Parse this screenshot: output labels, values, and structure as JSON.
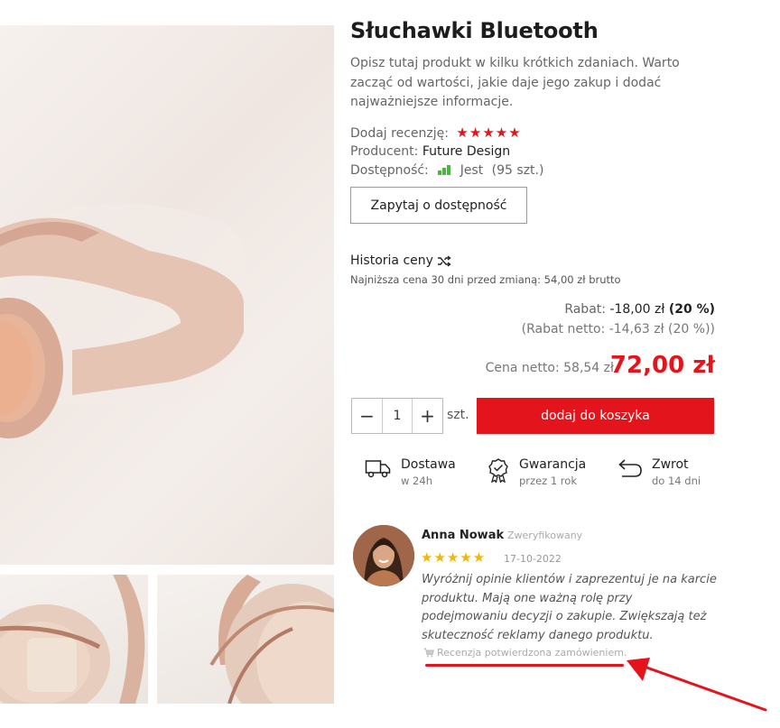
{
  "product": {
    "title": "Słuchawki Bluetooth",
    "description": "Opisz tutaj produkt w kilku krótkich zdaniach. Warto zacząć od wartości, jakie daje jego zakup i dodać najważniejsze informacje.",
    "review_label": "Dodaj recenzję:",
    "producer_label": "Producent:",
    "producer_value": "Future Design",
    "availability_label": "Dostępność:",
    "availability_value": "Jest",
    "availability_count": "(95 szt.)",
    "ask_button": "Zapytaj o dostępność"
  },
  "price_history": {
    "title": "Historia ceny",
    "note": "Najniższa cena 30 dni przed zmianą: 54,00 zł brutto"
  },
  "pricing": {
    "rabat_label": "Rabat:",
    "rabat_amount": "-18,00 zł",
    "rabat_percent": "(20 %)",
    "rabat_net": "(Rabat netto: -14,63 zł (20 %))",
    "net_price": "Cena netto: 58,54 zł",
    "price": "72,00 zł"
  },
  "cart": {
    "minus": "−",
    "quantity": "1",
    "plus": "+",
    "unit": "szt.",
    "add_button": "dodaj do koszyka"
  },
  "features": [
    {
      "title": "Dostawa",
      "sub": "w 24h"
    },
    {
      "title": "Gwarancja",
      "sub": "przez 1 rok"
    },
    {
      "title": "Zwrot",
      "sub": "do 14 dni"
    }
  ],
  "review": {
    "author": "Anna Nowak",
    "verified": "Zweryfikowany",
    "rating": 5,
    "date": "17-10-2022",
    "text": "Wyróżnij opinie klientów i zaprezentuj je na karcie produktu. Mają one ważną rolę przy podejmowaniu decyzji o zakupie. Zwiększają też skuteczność reklamy danego produktu.",
    "confirmed": "Recenzja potwierdzona zamówieniem."
  },
  "colors": {
    "accent": "#e3141c",
    "star_review": "#f2b705",
    "availability_bars": "#48b83c"
  }
}
